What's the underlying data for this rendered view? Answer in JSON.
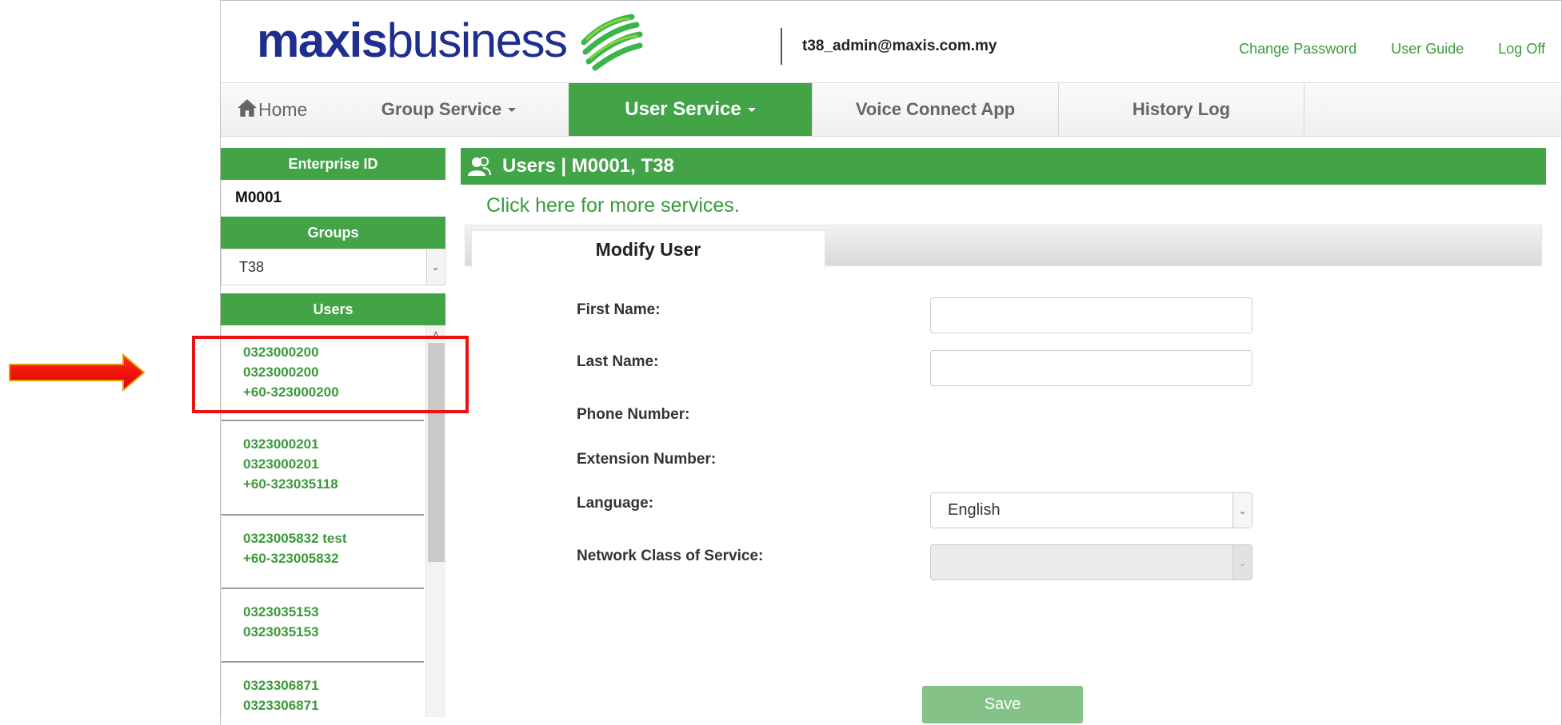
{
  "header": {
    "logo_bold": "maxis",
    "logo_light": "business",
    "user_email": "t38_admin@maxis.com.my",
    "links": [
      "Change Password",
      "User Guide",
      "Log Off"
    ]
  },
  "nav": {
    "home": "Home",
    "group_service": "Group Service",
    "user_service": "User Service",
    "voice_connect": "Voice Connect App",
    "history_log": "History Log",
    "active": "User Service"
  },
  "sidebar": {
    "enterprise_header": "Enterprise ID",
    "enterprise_value": "M0001",
    "groups_header": "Groups",
    "group_selected": "T38",
    "users_header": "Users",
    "users": [
      [
        "0323000200",
        "0323000200",
        "+60-323000200"
      ],
      [
        "0323000201",
        "0323000201",
        "+60-323035118"
      ],
      [
        "0323005832 test",
        "+60-323005832"
      ],
      [
        "0323035153",
        "0323035153"
      ],
      [
        "0323306871",
        "0323306871"
      ]
    ]
  },
  "main": {
    "title": "Users | M0001, T38",
    "more_services": "Click here for more services.",
    "tab": "Modify User",
    "form": {
      "first_name_label": "First Name:",
      "first_name_value": "",
      "last_name_label": "Last Name:",
      "last_name_value": "",
      "phone_label": "Phone Number:",
      "extension_label": "Extension Number:",
      "language_label": "Language:",
      "language_value": "English",
      "ncos_label": "Network Class of Service:",
      "ncos_value": ""
    },
    "save": "Save"
  },
  "colors": {
    "brand_green": "#43a347",
    "link_green": "#3a9a3a",
    "logo_blue": "#1f2f8f",
    "annotation_red": "#ee1111"
  },
  "icons": [
    "home-icon",
    "users-group-icon",
    "maxis-swirl-logo",
    "chevron-down-icon",
    "scroll-up-icon",
    "annotation-arrow"
  ]
}
